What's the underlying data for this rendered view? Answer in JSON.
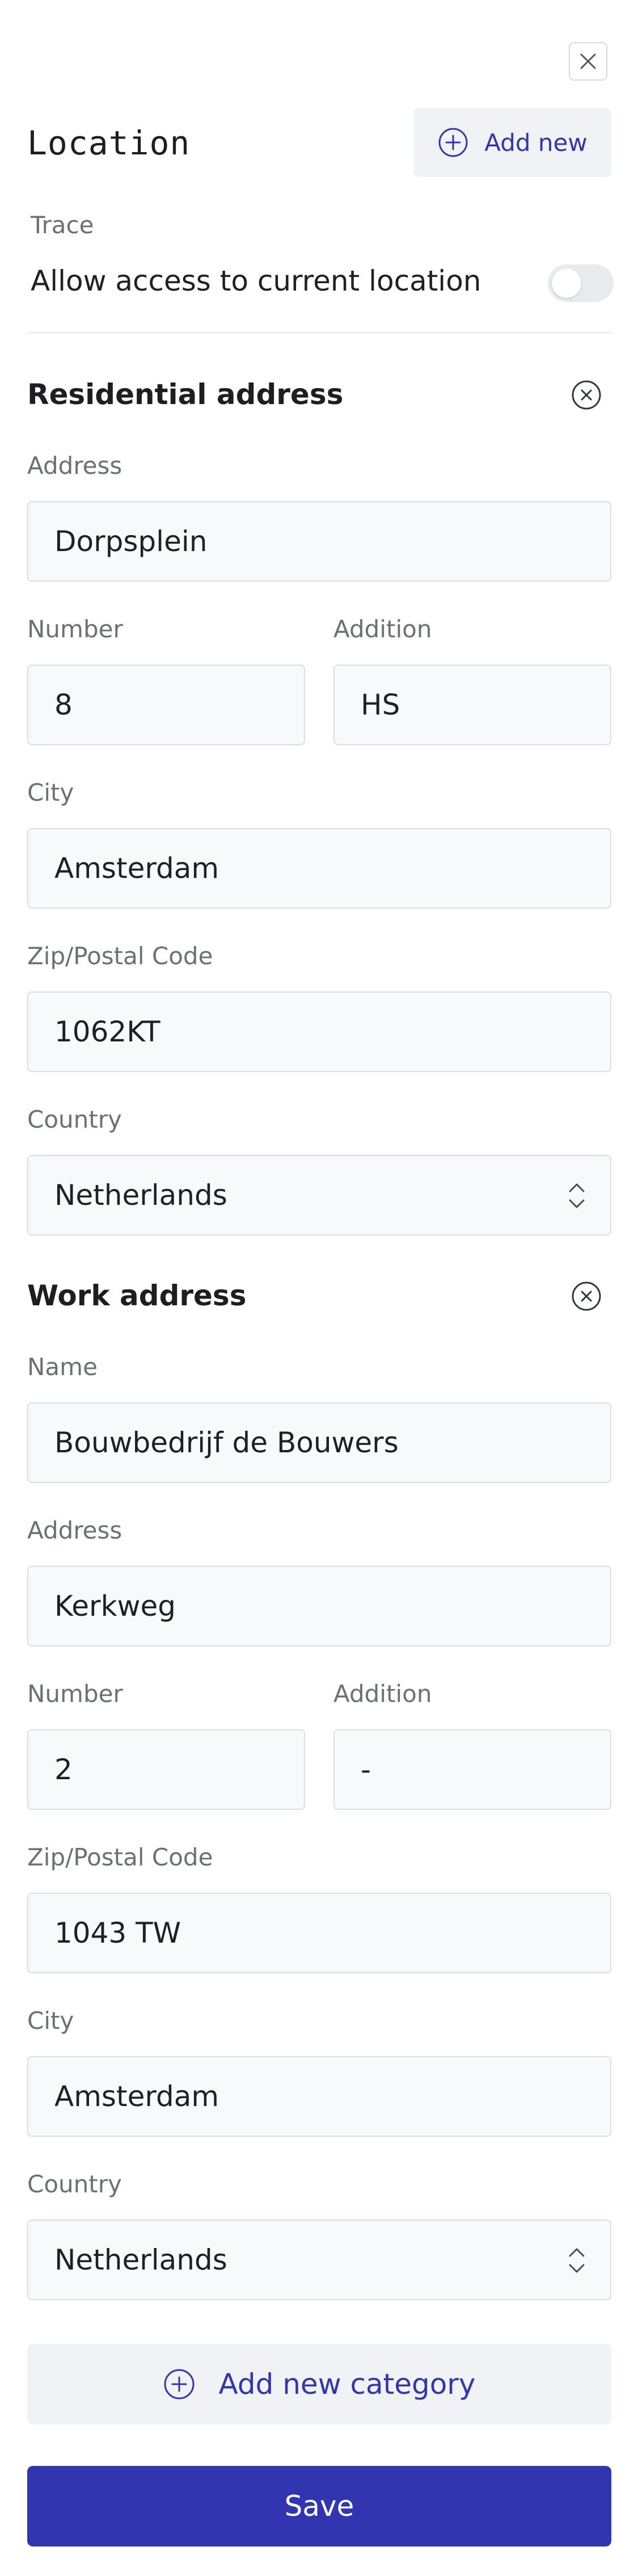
{
  "header": {
    "title": "Location",
    "add_new_label": "Add new"
  },
  "trace": {
    "label": "Trace",
    "toggle_label": "Allow access to current location",
    "enabled": false
  },
  "residential": {
    "title": "Residential address",
    "address_label": "Address",
    "address_value": "Dorpsplein",
    "number_label": "Number",
    "number_value": "8",
    "addition_label": "Addition",
    "addition_value": "HS",
    "city_label": "City",
    "city_value": "Amsterdam",
    "zip_label": "Zip/Postal Code",
    "zip_value": "1062KT",
    "country_label": "Country",
    "country_value": "Netherlands"
  },
  "work": {
    "title": "Work address",
    "name_label": "Name",
    "name_value": "Bouwbedrijf de Bouwers",
    "address_label": "Address",
    "address_value": "Kerkweg",
    "number_label": "Number",
    "number_value": "2",
    "addition_label": "Addition",
    "addition_value": "-",
    "zip_label": "Zip/Postal Code",
    "zip_value": "1043 TW",
    "city_label": "City",
    "city_value": "Amsterdam",
    "country_label": "Country",
    "country_value": "Netherlands"
  },
  "footer": {
    "add_category_label": "Add new category",
    "save_label": "Save"
  },
  "colors": {
    "accent": "#3136b0",
    "field_bg": "#f8f9fb",
    "field_border": "#dcdee4"
  },
  "icons": [
    "close-icon",
    "plus-circle-icon",
    "remove-circle-icon",
    "chevron-up-down-icon"
  ]
}
